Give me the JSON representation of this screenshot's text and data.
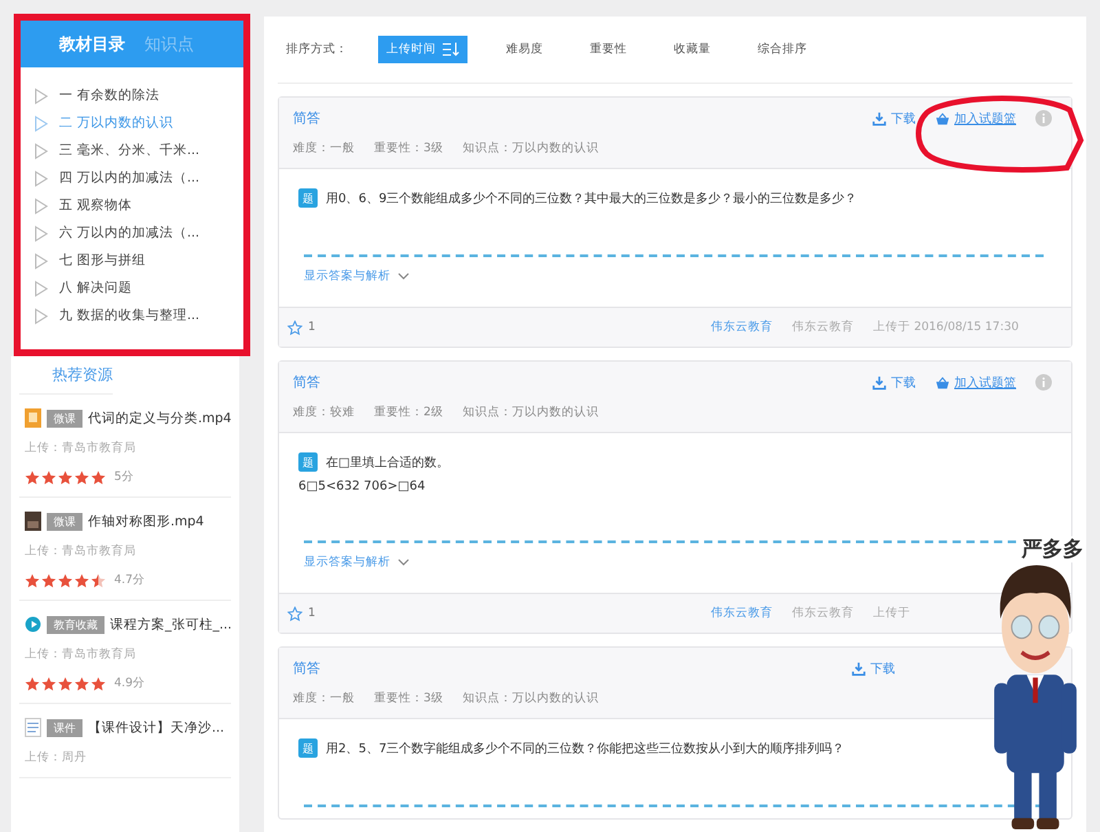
{
  "sidebar": {
    "tabs": [
      {
        "label": "教材目录",
        "selected": true
      },
      {
        "label": "知识点",
        "selected": false
      }
    ],
    "chapters": [
      {
        "label": "一 有余数的除法",
        "selected": false
      },
      {
        "label": "二 万以内数的认识",
        "selected": true
      },
      {
        "label": "三 毫米、分米、千米...",
        "selected": false
      },
      {
        "label": "四 万以内的加减法（...",
        "selected": false
      },
      {
        "label": "五 观察物体",
        "selected": false
      },
      {
        "label": "六 万以内的加减法（...",
        "selected": false
      },
      {
        "label": "七 图形与拼组",
        "selected": false
      },
      {
        "label": "八 解决问题",
        "selected": false
      },
      {
        "label": "九 数据的收集与整理...",
        "selected": false
      }
    ]
  },
  "hot_resources": {
    "title": "热荐资源",
    "items": [
      {
        "kind": "thumb",
        "tag": "微课",
        "title": "代词的定义与分类.mp4",
        "uploader": "上传：青岛市教育局",
        "stars": 5,
        "score": "5分"
      },
      {
        "kind": "photo",
        "tag": "微课",
        "title": "作轴对称图形.mp4",
        "uploader": "上传：青岛市教育局",
        "stars": 4.5,
        "score": "4.7分"
      },
      {
        "kind": "circle",
        "tag": "教育收藏",
        "title": "课程方案_张可柱_...",
        "uploader": "上传：青岛市教育局",
        "stars": 5,
        "score": "4.9分"
      },
      {
        "kind": "doc",
        "tag": "课件",
        "title": "【课件设计】天净沙...",
        "uploader": "上传：周丹"
      }
    ]
  },
  "sort_bar": {
    "label": "排序方式：",
    "options": [
      {
        "label": "上传时间",
        "selected": true
      },
      {
        "label": "难易度",
        "selected": false
      },
      {
        "label": "重要性",
        "selected": false
      },
      {
        "label": "收藏量",
        "selected": false
      },
      {
        "label": "综合排序",
        "selected": false
      }
    ]
  },
  "questions": [
    {
      "type": "简答",
      "download": "下载",
      "add": "加入试题篮",
      "difficulty": "难度：一般",
      "importance": "重要性：3级",
      "knowledge": "知识点：万以内数的认识",
      "badge": "题",
      "lines": [
        "用0、6、9三个数能组成多少个不同的三位数？其中最大的三位数是多少？最小的三位数是多少？"
      ],
      "toggle": "显示答案与解析",
      "favorites": "1",
      "source": "伟东云教育",
      "author": "伟东云教育",
      "uploaded": "上传于 2016/08/15 17:30"
    },
    {
      "type": "简答",
      "download": "下载",
      "add": "加入试题篮",
      "difficulty": "难度：较难",
      "importance": "重要性：2级",
      "knowledge": "知识点：万以内数的认识",
      "badge": "题",
      "lines": [
        "在□里填上合适的数。",
        "6□5<632 706>□64"
      ],
      "toggle": "显示答案与解析",
      "favorites": "1",
      "source": "伟东云教育",
      "author": "伟东云教育",
      "uploaded": "上传于"
    },
    {
      "type": "简答",
      "download": "下载",
      "difficulty": "难度：一般",
      "importance": "重要性：3级",
      "knowledge": "知识点：万以内数的认识",
      "badge": "题",
      "lines": [
        "用2、5、7三个数字能组成多少个不同的三位数？你能把这些三位数按从小到大的顺序排列吗？"
      ]
    }
  ],
  "presenter": {
    "name": "严多多"
  }
}
